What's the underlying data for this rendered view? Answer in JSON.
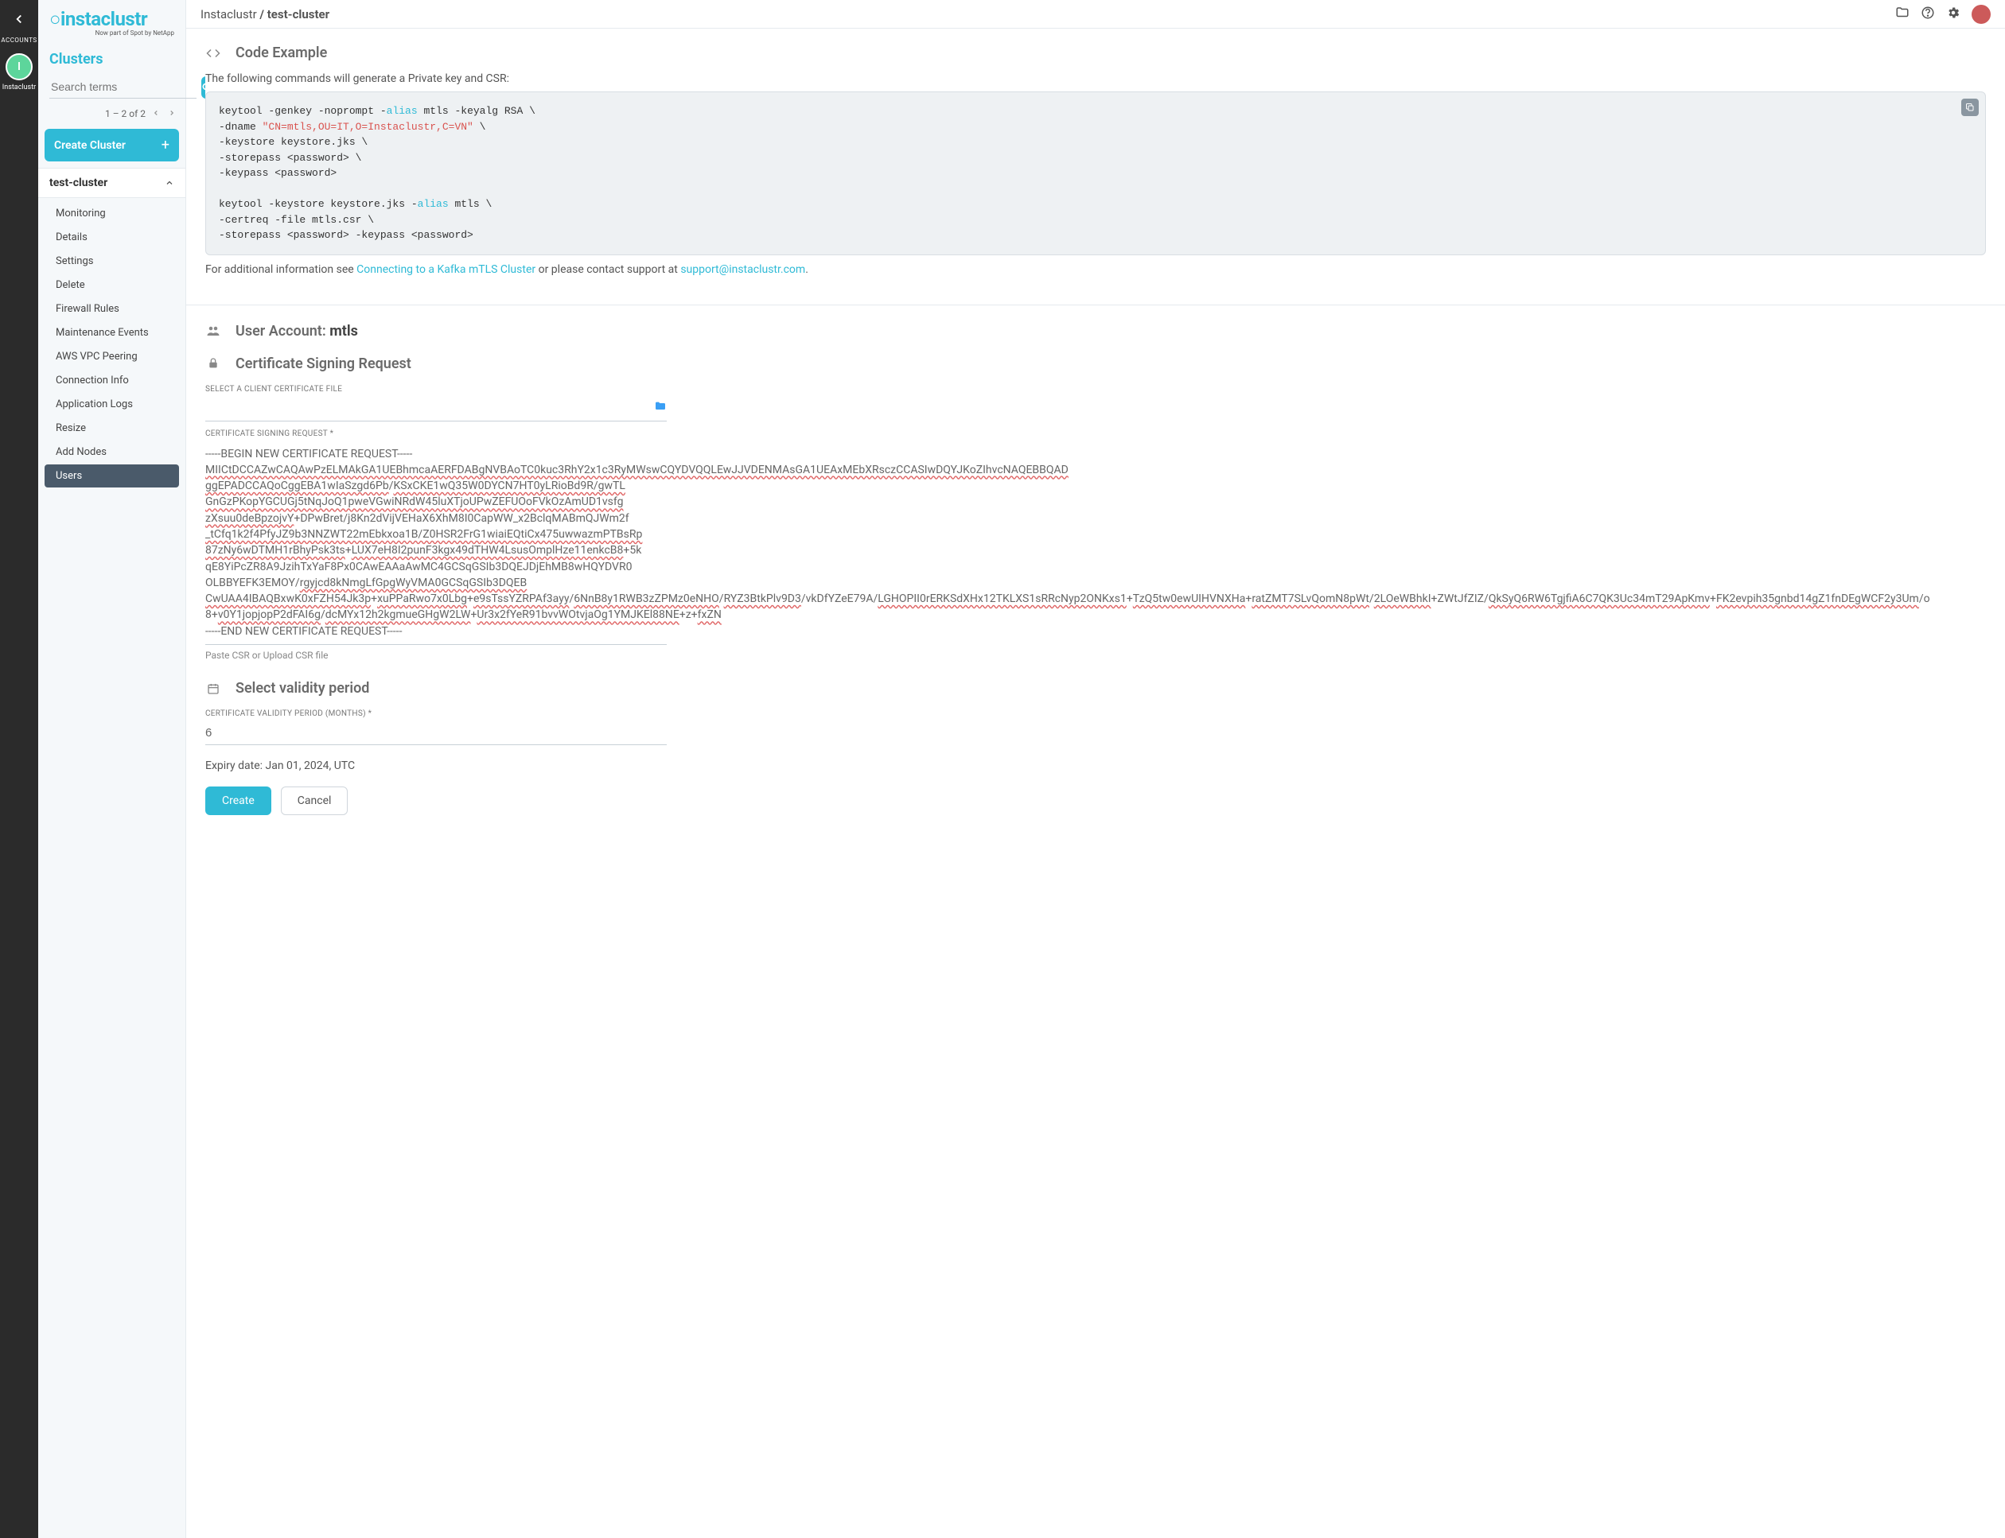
{
  "darkbar": {
    "accounts_label": "ACCOUNTS",
    "avatar_letter": "I",
    "acct_name": "Instaclustr"
  },
  "sidebar": {
    "logo": "instaclustr",
    "logo_sub": "Now part of Spot by NetApp",
    "clusters_heading": "Clusters",
    "search_placeholder": "Search terms",
    "pager": "1 – 2 of 2",
    "create_label": "Create Cluster",
    "cluster_name": "test-cluster",
    "nav": [
      {
        "label": "Monitoring"
      },
      {
        "label": "Details"
      },
      {
        "label": "Settings"
      },
      {
        "label": "Delete"
      },
      {
        "label": "Firewall Rules"
      },
      {
        "label": "Maintenance Events"
      },
      {
        "label": "AWS VPC Peering"
      },
      {
        "label": "Connection Info"
      },
      {
        "label": "Application Logs"
      },
      {
        "label": "Resize"
      },
      {
        "label": "Add Nodes"
      },
      {
        "label": "Users"
      }
    ],
    "nav_active": "Users"
  },
  "breadcrumb": {
    "root": "Instaclustr",
    "sep": " / ",
    "leaf": "test-cluster"
  },
  "code_example": {
    "title": "Code Example",
    "desc": "The following commands will generate a Private key and CSR:",
    "info_prefix": "For additional information see ",
    "link1": "Connecting to a Kafka mTLS Cluster",
    "info_mid": " or please contact support at ",
    "link2": "support@instaclustr.com",
    "info_suffix": "."
  },
  "user_account": {
    "prefix": "User Account: ",
    "name": "mtls"
  },
  "csr": {
    "title": "Certificate Signing Request",
    "file_label": "SELECT A CLIENT CERTIFICATE FILE",
    "area_label": "CERTIFICATE SIGNING REQUEST *",
    "help": "Paste CSR or Upload CSR file",
    "begin": "-----BEGIN NEW CERTIFICATE REQUEST-----",
    "end": "-----END NEW CERTIFICATE REQUEST-----"
  },
  "validity": {
    "title": "Select validity period",
    "label": "CERTIFICATE VALIDITY PERIOD (MONTHS) *",
    "value": "6",
    "expiry": "Expiry date: Jan 01, 2024, UTC"
  },
  "buttons": {
    "create": "Create",
    "cancel": "Cancel"
  }
}
